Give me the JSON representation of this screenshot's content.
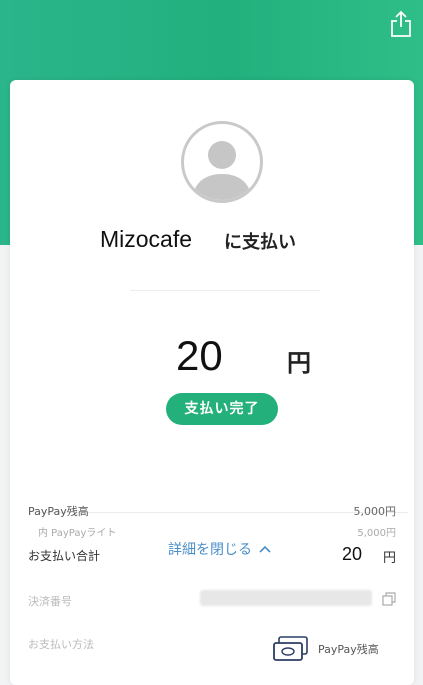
{
  "header": {
    "share_icon": "share-icon",
    "accent_color": "#23b07a"
  },
  "merchant": {
    "name": "Mizocafe",
    "suffix": "に支払い"
  },
  "payment": {
    "amount": "20",
    "currency": "円",
    "status": "支払い完了"
  },
  "details": {
    "toggle_label": "詳細を閉じる",
    "balance_label": "PayPay残高",
    "balance_value": "5,000円",
    "balance_sub_label": "内 PayPayライト",
    "balance_sub_value": "5,000円",
    "total_label": "お支払い合計",
    "total_value": "20",
    "total_currency": "円",
    "transaction_label": "決済番号",
    "method_label": "お支払い方法",
    "method_value": "PayPay残高"
  }
}
